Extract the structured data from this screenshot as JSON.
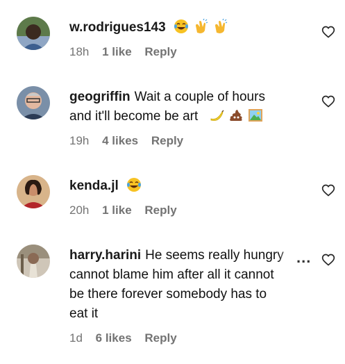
{
  "comments": [
    {
      "username": "w.rodrigues143",
      "text": "",
      "emojis": [
        "joy-tears-icon",
        "clap-icon",
        "clap-icon"
      ],
      "time": "18h",
      "likes": "1 like",
      "reply": "Reply"
    },
    {
      "username": "geogriffin",
      "text_line1": "Wait a couple of hours",
      "text_line2": "and it'll become be art",
      "emojis": [
        "banana-icon",
        "poop-icon",
        "framed-picture-icon"
      ],
      "time": "19h",
      "likes": "4 likes",
      "reply": "Reply"
    },
    {
      "username": "kenda.jl",
      "text": "",
      "emojis": [
        "joy-tears-icon"
      ],
      "time": "20h",
      "likes": "1 like",
      "reply": "Reply"
    },
    {
      "username": "harry.harini",
      "text_line1": "He seems really hungry",
      "text_line2": "cannot blame him after all it cannot",
      "text_line3": "be there forever somebody has to",
      "text_line4": "eat it",
      "time": "1d",
      "likes": "6 likes",
      "reply": "Reply"
    }
  ],
  "more_label": "...",
  "colors": {
    "text": "#111111",
    "meta": "#737373",
    "heart_stroke": "#262626"
  }
}
